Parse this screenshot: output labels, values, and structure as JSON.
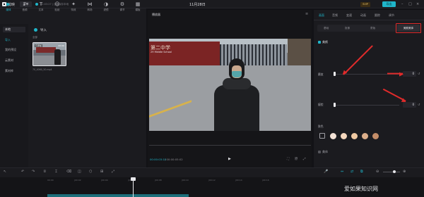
{
  "titlebar": {
    "app_name": "剪映",
    "menu_label": "菜单",
    "project_status": "01:03:27 | 自动保存本地",
    "doc_title": "11月28日",
    "vip_label": "SVIP",
    "export_label": "导出",
    "win_minimize": "–",
    "win_maximize": "□",
    "win_close": "×"
  },
  "toolbar": {
    "items": [
      {
        "label": "媒体",
        "icon": "media-icon",
        "glyph": "▶"
      },
      {
        "label": "音频",
        "icon": "audio-icon",
        "glyph": "♪"
      },
      {
        "label": "文本",
        "icon": "text-icon",
        "glyph": "T"
      },
      {
        "label": "贴纸",
        "icon": "sticker-icon",
        "glyph": "☺"
      },
      {
        "label": "特效",
        "icon": "effects-icon",
        "glyph": "✦"
      },
      {
        "label": "转场",
        "icon": "transition-icon",
        "glyph": "⋈"
      },
      {
        "label": "滤镜",
        "icon": "filter-icon",
        "glyph": "◑"
      },
      {
        "label": "调节",
        "icon": "adjust-icon",
        "glyph": "⚙"
      },
      {
        "label": "模板",
        "icon": "template-icon",
        "glyph": "▦"
      }
    ]
  },
  "leftnav": {
    "items": [
      "本地",
      "导入",
      "我的预设",
      "云素材",
      "素材库"
    ]
  },
  "media": {
    "import_label": "导入",
    "all_label": "全部",
    "clip": {
      "added_label": "已添加",
      "duration": "00:06",
      "filename": "70_4060_50.mp4"
    }
  },
  "player": {
    "title": "播放器",
    "menu_glyph": "≡",
    "video_wall_text": "第二中学",
    "video_school_text": "29 Middle School",
    "timecode_current": "00:00:03:15",
    "timecode_total": "/ 00:00:05:02",
    "play_glyph": "▶",
    "ctrl_fullscreen": "⛶",
    "ctrl_ratio": "原",
    "ctrl_full": "⤢"
  },
  "props": {
    "tabs": [
      "画面",
      "音频",
      "变速",
      "动画",
      "跟踪",
      "调节"
    ],
    "segments": [
      "基础",
      "抠像",
      "蒙版",
      "美颜美体"
    ],
    "beauty": {
      "label": "美颜",
      "smooth_label": "磨皮",
      "smooth_value": "0",
      "thin_label": "瘦脸",
      "thin_value": "0",
      "reset_glyph": "↺"
    },
    "skin": {
      "label": "肤色",
      "swatches": [
        "#f3e2d6",
        "#f5d7bd",
        "#efc9a2",
        "#dcae8a",
        "#c48d68"
      ]
    },
    "body": {
      "label": "美体"
    }
  },
  "timeline": {
    "tools": [
      "↖",
      "↶",
      "↷",
      "⌷",
      "⌶",
      "⌫",
      "◫",
      "⬡",
      "⊞",
      "⤢"
    ],
    "right_tools": [
      "🎤",
      "⇔",
      "⇄",
      "⧉",
      "⊖",
      "⊕"
    ],
    "ruler": [
      "00:00",
      "|00:02",
      "|00:04",
      "|00:06",
      "|00:08",
      "|00:10",
      "|00:12",
      "|00:14",
      "|00:16"
    ]
  },
  "watermark": "爱如果知识网",
  "accent_color": "#1fb5c9",
  "annotation_color": "#e02b2b"
}
